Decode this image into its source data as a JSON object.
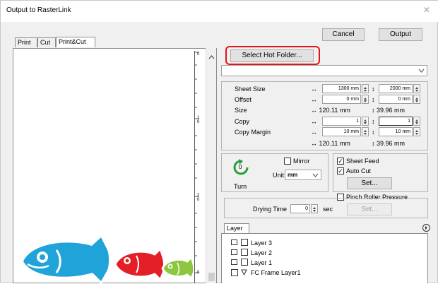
{
  "window": {
    "title": "Output to RasterLink",
    "close_glyph": "✕"
  },
  "toolbar": {
    "cancel_label": "Cancel",
    "output_label": "Output"
  },
  "tabs": [
    {
      "label": "Print",
      "active": false
    },
    {
      "label": "Cut",
      "active": false
    },
    {
      "label": "Print&Cut",
      "active": true
    }
  ],
  "ruler_labels": [
    "0",
    "10",
    "20",
    "0"
  ],
  "hot_folder": {
    "button_label": "Select Hot Folder...",
    "dropdown_value": ""
  },
  "size": {
    "sheet_label": "Sheet Size",
    "sheet_w": "1300 mm",
    "sheet_h": "2000 mm",
    "offset_label": "Offset",
    "offset_x": "0 mm",
    "offset_y": "0 mm",
    "size_label": "Size",
    "size_w": "↔ 120.11 mm",
    "size_h": "↕ 39.96 mm",
    "copy_label": "Copy",
    "copy_x": "1",
    "copy_y": "1",
    "margin_label": "Copy Margin",
    "margin_x": "10 mm",
    "margin_y": "10 mm",
    "total_w": "↔ 120.11 mm",
    "total_h": "↕ 39.96 mm",
    "arrow_h": "↔",
    "arrow_v": "↕"
  },
  "orientation": {
    "rotation_value": "0",
    "turn_label": "Turn",
    "mirror_label": "Mirror",
    "unit_label": "Unit:",
    "unit_value": "mm",
    "mirror_checked": false
  },
  "cut_options": {
    "sheet_feed_label": "Sheet Feed",
    "sheet_feed_checked": true,
    "auto_cut_label": "Auto Cut",
    "auto_cut_checked": true,
    "set_label": "Set...",
    "pinch_label": "Pinch Roller Pressure",
    "pinch_checked": false,
    "set2_label": "Set..."
  },
  "drying": {
    "label": "Drying Time",
    "value": "0",
    "unit": "sec"
  },
  "layers": {
    "tab_label": "Layer",
    "items": [
      {
        "label": "Layer 3",
        "checked": false
      },
      {
        "label": "Layer 2",
        "checked": false
      },
      {
        "label": "Layer 1",
        "checked": false
      },
      {
        "label": "FC Frame Layer1",
        "checked": false
      }
    ]
  },
  "colors": {
    "fish_blue": "#1fa3d8",
    "fish_red": "#e41e26",
    "fish_green": "#8dc63f",
    "highlight": "#e0141b"
  }
}
